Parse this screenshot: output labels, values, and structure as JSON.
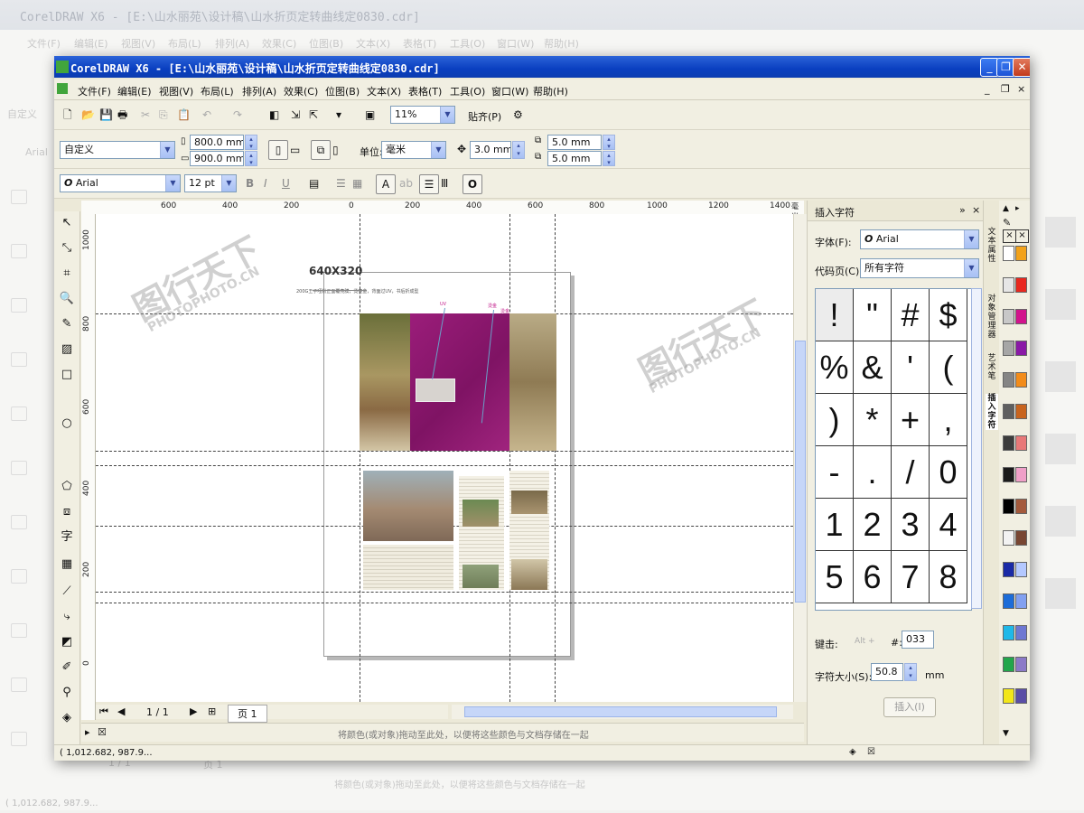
{
  "background": {
    "ghost_title": "CorelDRAW X6 - [E:\\山水丽苑\\设计稿\\山水折页定转曲线定0830.cdr]",
    "ghost_menu": [
      "文件(F)",
      "编辑(E)",
      "视图(V)",
      "布局(L)",
      "排列(A)",
      "效果(C)",
      "位图(B)",
      "文本(X)",
      "表格(T)",
      "工具(O)",
      "窗口(W)",
      "帮助(H)"
    ],
    "ghost_preset": "自定义",
    "ghost_font": "Arial",
    "ghost_page_count": "1 / 1",
    "ghost_page_tab": "页 1",
    "ghost_hint": "将颜色(或对象)拖动至此处，以便将这些颜色与文档存储在一起",
    "ghost_coords": "( 1,012.682, 987.9..."
  },
  "window": {
    "title": "CorelDRAW X6 - [E:\\山水丽苑\\设计稿\\山水折页定转曲线定0830.cdr]",
    "buttons": {
      "minimize": "_",
      "restore": "❐",
      "close": "✕"
    }
  },
  "menu": {
    "items": [
      "文件(F)",
      "编辑(E)",
      "视图(V)",
      "布局(L)",
      "排列(A)",
      "效果(C)",
      "位图(B)",
      "文本(X)",
      "表格(T)",
      "工具(O)",
      "窗口(W)",
      "帮助(H)"
    ],
    "doc_controls": [
      "_",
      "❐",
      "×"
    ]
  },
  "standard_toolbar": {
    "zoom": "11%",
    "snap_label": "贴齐(P)"
  },
  "property_bar": {
    "preset": "自定义",
    "width": "800.0 mm",
    "height": "900.0 mm",
    "units_label": "单位:",
    "units": "毫米",
    "nudge": "3.0 mm",
    "dup_x": "5.0 mm",
    "dup_y": "5.0 mm"
  },
  "text_bar": {
    "font": "Arial",
    "size": "12 pt"
  },
  "rulers": {
    "h_ticks": [
      "600",
      "400",
      "200",
      "0",
      "200",
      "400",
      "600",
      "800",
      "1000",
      "1200",
      "1400"
    ],
    "h_unit": "毫米",
    "v_ticks": [
      "1000",
      "800",
      "600",
      "400",
      "200",
      "0"
    ],
    "v_unit": "毫米"
  },
  "document": {
    "size_label": "640X320",
    "spec_text": "200G王子哑粉正面覆亮膜，烫亮金，背面过UV，书后折成型",
    "annotation_uv": "UV",
    "annotation_gold1": "烫金",
    "annotation_gold2": "烫金"
  },
  "page_nav": {
    "count": "1 / 1",
    "tab": "页 1"
  },
  "palette_bar": {
    "hint": "将颜色(或对象)拖动至此处，以便将这些颜色与文档存储在一起"
  },
  "status": {
    "coords": "( 1,012.682, 987.9..."
  },
  "docker": {
    "title": "插入字符",
    "font_label": "字体(F):",
    "font_value": "Arial",
    "codepage_label": "代码页(C):",
    "codepage_value": "所有字符",
    "chars": [
      "!",
      "\"",
      "#",
      "$",
      "%",
      "&",
      "'",
      "(",
      ")",
      "*",
      "+",
      ",",
      "-",
      ".",
      "/",
      "0",
      "1",
      "2",
      "3",
      "4",
      "5",
      "6",
      "7",
      "8"
    ],
    "key_label": "键击:",
    "key_alt": "Alt +",
    "code_label": "#:",
    "code_value": "033",
    "size_label": "字符大小(S):",
    "size_value": "50.8",
    "size_unit": "mm",
    "insert_button": "插入(I)"
  },
  "docker_tabs": [
    "文本属性",
    "对象管理器",
    "艺术笔",
    "插入字符"
  ],
  "palette": {
    "colors": [
      "#ffffff",
      "#e6e6e6",
      "#c8c8c8",
      "#a6a6a6",
      "#858585",
      "#5f5f5f",
      "#3c3c3c",
      "#1a1a1a",
      "#000000",
      "#f2f2f2",
      "#1a2aa6",
      "#1c6cd8",
      "#1fb8e8",
      "#22a64b",
      "#f2e61a",
      "#f2a21a",
      "#e8281e",
      "#d2148c",
      "#8a1aa6",
      "#f28c1a",
      "#c8641e",
      "#e87878",
      "#f0a0c8",
      "#a45a3c",
      "#784632",
      "#b4c8ff",
      "#82a0f0",
      "#6e78d2",
      "#8c7ac8",
      "#5a4ea6"
    ]
  },
  "watermark": {
    "brand": "图行天下",
    "url": "PHOTOPHOTO.CN"
  }
}
